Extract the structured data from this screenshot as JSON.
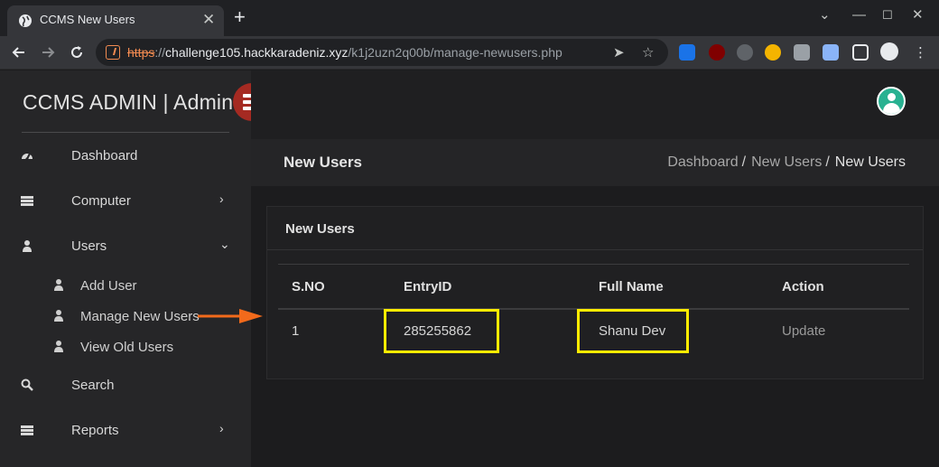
{
  "browser": {
    "tab_title": "CCMS New Users",
    "url_scheme": "https",
    "url_sep": "://",
    "url_host": "challenge105.hackkaradeniz.xyz",
    "url_path": "/k1j2uzn2q00b/manage-newusers.php"
  },
  "sidebar": {
    "brand": "CCMS ADMIN | Admin",
    "items": [
      {
        "label": "Dashboard",
        "icon": "dashboard-icon"
      },
      {
        "label": "Computer",
        "icon": "server-icon"
      },
      {
        "label": "Users",
        "icon": "user-icon"
      },
      {
        "label": "Search",
        "icon": "search-icon"
      },
      {
        "label": "Reports",
        "icon": "server-icon"
      }
    ],
    "user_subitems": [
      {
        "label": "Add User"
      },
      {
        "label": "Manage New Users"
      },
      {
        "label": "View Old Users"
      }
    ]
  },
  "header": {
    "title": "New Users",
    "breadcrumb": [
      "Dashboard",
      "New Users",
      "New Users"
    ]
  },
  "card": {
    "title": "New Users",
    "columns": [
      "S.NO",
      "EntryID",
      "Full Name",
      "Action"
    ],
    "rows": [
      {
        "sno": "1",
        "entry_id": "285255862",
        "full_name": "Shanu Dev",
        "action": "Update"
      }
    ]
  },
  "colors": {
    "highlight": "#ffeb00",
    "arrow": "#f26a1b",
    "brand_button": "#a52a22",
    "avatar": "#28b191"
  }
}
